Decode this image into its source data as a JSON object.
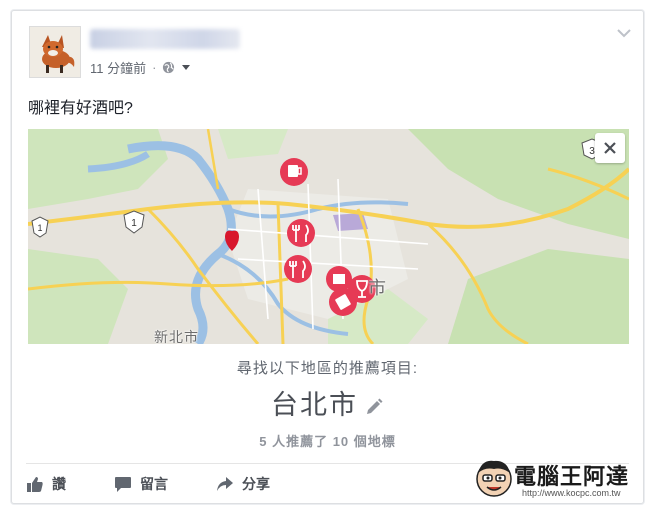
{
  "post": {
    "timestamp": "11 分鐘前",
    "separator": "·",
    "text": "哪裡有好酒吧?"
  },
  "map": {
    "labels": {
      "city": "市",
      "new_taipei": "新北市"
    },
    "shields": [
      "1",
      "3"
    ]
  },
  "recommendation": {
    "prompt": "尋找以下地區的推薦項目:",
    "city": "台北市",
    "count_text": "5 人推薦了 10 個地標"
  },
  "actions": {
    "like": "讚",
    "comment": "留言",
    "share": "分享"
  },
  "watermark": {
    "brand": "電腦王阿達",
    "url": "http://www.kocpc.com.tw"
  },
  "colors": {
    "pin": "#e63a55",
    "road_major": "#f7d154",
    "water": "#9cc0e4",
    "park": "#c9e2b4",
    "text_secondary": "#616770"
  }
}
